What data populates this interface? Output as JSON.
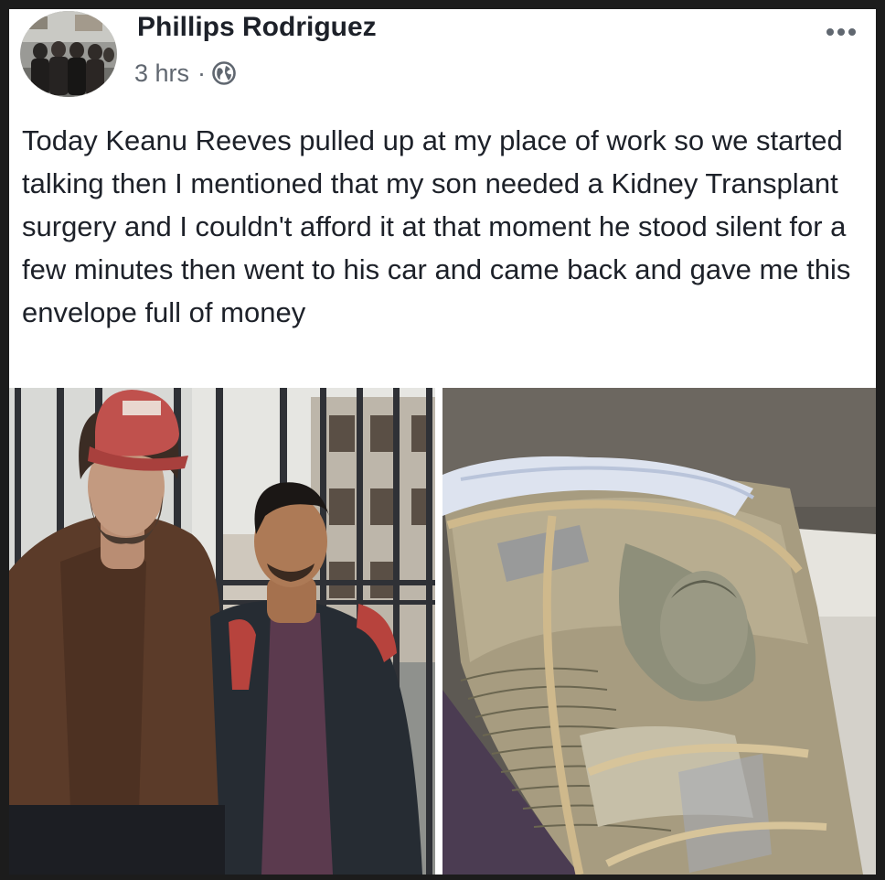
{
  "post": {
    "author": "Phillips Rodriguez",
    "timestamp": "3 hrs",
    "separator": "·",
    "privacy_icon": "globe-icon",
    "more_icon": "more-options-icon",
    "body": "Today Keanu Reeves pulled up at my place of work so we started talking then I mentioned that my son needed a Kidney Transplant surgery and I couldn't afford it at that moment he stood silent for a few minutes then went to his car and came back and gave me this envelope full of money"
  },
  "colors": {
    "text": "#1d2129",
    "secondary_text": "#606770",
    "card_background": "#ffffff",
    "page_background": "#1c1c1c"
  }
}
